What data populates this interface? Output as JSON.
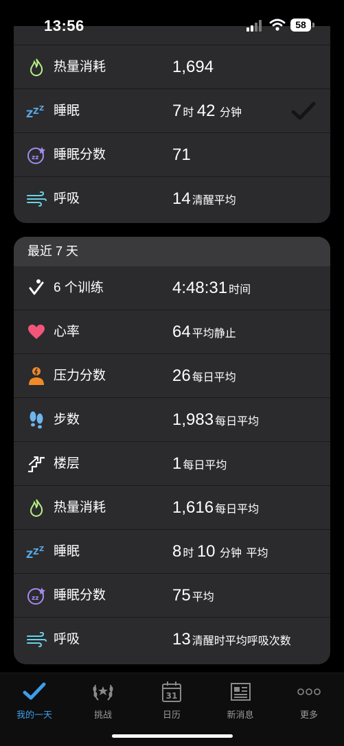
{
  "status_bar": {
    "time": "13:56",
    "battery": "58"
  },
  "today": {
    "rows": [
      {
        "id": "calories",
        "label": "热量消耗",
        "value": "1,694",
        "unit": ""
      },
      {
        "id": "sleep",
        "label": "睡眠",
        "hours": "7",
        "hours_unit": "时",
        "minutes": "42",
        "minutes_unit": "分钟"
      },
      {
        "id": "sleep-score",
        "label": "睡眠分数",
        "value": "71",
        "unit": ""
      },
      {
        "id": "respiration",
        "label": "呼吸",
        "value": "14",
        "unit": "清醒平均"
      }
    ]
  },
  "last7": {
    "header": "最近 7 天",
    "rows": [
      {
        "id": "workouts",
        "label": "6 个训练",
        "value": "4:48:31",
        "unit": "时间"
      },
      {
        "id": "heart-rate",
        "label": "心率",
        "value": "64",
        "unit": "平均静止"
      },
      {
        "id": "stress",
        "label": "压力分数",
        "value": "26",
        "unit": "每日平均"
      },
      {
        "id": "steps",
        "label": "步数",
        "value": "1,983",
        "unit": "每日平均"
      },
      {
        "id": "floors",
        "label": "楼层",
        "value": "1",
        "unit": "每日平均"
      },
      {
        "id": "calories",
        "label": "热量消耗",
        "value": "1,616",
        "unit": "每日平均"
      },
      {
        "id": "sleep",
        "label": "睡眠",
        "hours": "8",
        "hours_unit": "时",
        "minutes": "10",
        "minutes_unit": "分钟",
        "suffix": "平均"
      },
      {
        "id": "sleep-score",
        "label": "睡眠分数",
        "value": "75",
        "unit": "平均"
      },
      {
        "id": "respiration",
        "label": "呼吸",
        "value": "13",
        "unit": "清醒时平均呼吸次数"
      }
    ]
  },
  "tabbar": {
    "tabs": [
      {
        "label": "我的一天",
        "icon": "checkmark-icon",
        "active": true
      },
      {
        "label": "挑战",
        "icon": "laurel-icon",
        "active": false
      },
      {
        "label": "日历",
        "icon": "calendar-icon",
        "active": false,
        "icon_text": "31"
      },
      {
        "label": "新消息",
        "icon": "newspaper-icon",
        "active": false
      },
      {
        "label": "更多",
        "icon": "more-icon",
        "active": false
      }
    ]
  },
  "colors": {
    "accent": "#3d9ee8",
    "card": "#2b2b2d",
    "card_header": "#3a3a3d",
    "flame": "#b7f086",
    "sleep": "#5aa9e6",
    "sleep_score": "#a58bf0",
    "respiration": "#69d2e7",
    "heart": "#f2557a",
    "stress": "#f08a28",
    "steps": "#6db6f0"
  }
}
